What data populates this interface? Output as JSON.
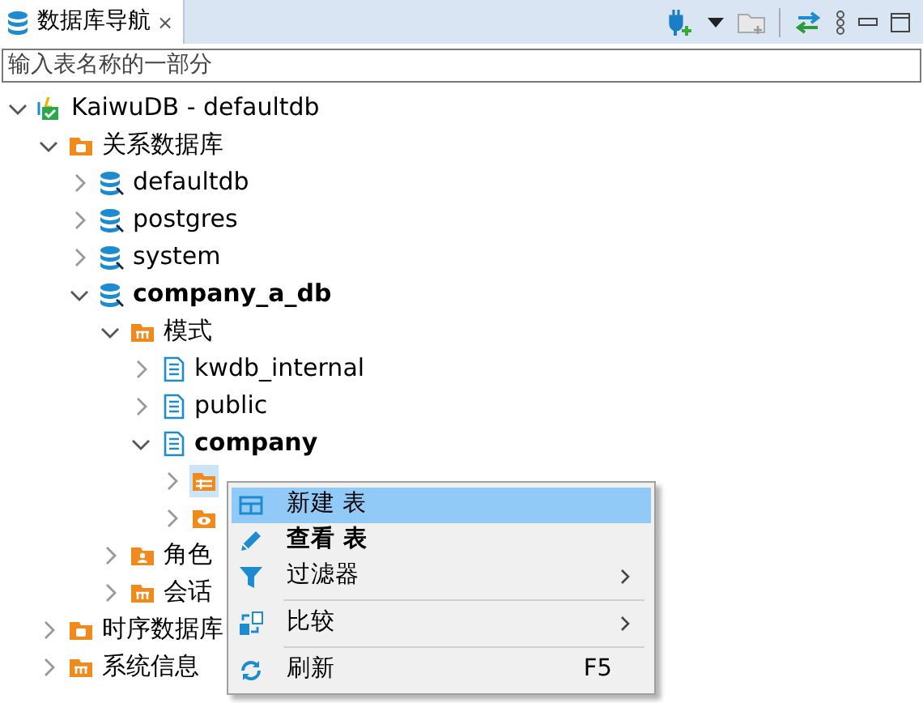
{
  "tab": {
    "title": "数据库导航",
    "close": "⨯"
  },
  "search": {
    "placeholder": "输入表名称的一部分"
  },
  "tree": [
    {
      "label": "KaiwuDB - defaultdb",
      "kind": "connection",
      "expanded": true,
      "bold": false,
      "selected": false,
      "children": [
        {
          "label": "关系数据库",
          "kind": "folder",
          "expanded": true,
          "bold": false,
          "selected": false,
          "children": [
            {
              "label": "defaultdb",
              "kind": "database",
              "expanded": false,
              "bold": false,
              "selected": false
            },
            {
              "label": "postgres",
              "kind": "database",
              "expanded": false,
              "bold": false,
              "selected": false
            },
            {
              "label": "system",
              "kind": "database",
              "expanded": false,
              "bold": false,
              "selected": false
            },
            {
              "label": "company_a_db",
              "kind": "database",
              "expanded": true,
              "bold": true,
              "selected": false,
              "children": [
                {
                  "label": "模式",
                  "kind": "grid",
                  "expanded": true,
                  "bold": false,
                  "selected": false,
                  "children": [
                    {
                      "label": "kwdb_internal",
                      "kind": "schema",
                      "expanded": false,
                      "bold": false,
                      "selected": false
                    },
                    {
                      "label": "public",
                      "kind": "schema",
                      "expanded": false,
                      "bold": false,
                      "selected": false
                    },
                    {
                      "label": "company",
                      "kind": "schema",
                      "expanded": true,
                      "bold": true,
                      "selected": false,
                      "children": [
                        {
                          "kind": "tables",
                          "expanded": false,
                          "selected": true
                        },
                        {
                          "kind": "views",
                          "expanded": false,
                          "selected": false
                        }
                      ]
                    }
                  ]
                },
                {
                  "label": "角色",
                  "kind": "roles",
                  "expanded": false,
                  "bold": false,
                  "selected": false
                },
                {
                  "label": "会话",
                  "kind": "grid",
                  "expanded": false,
                  "bold": false,
                  "selected": false
                }
              ]
            }
          ]
        },
        {
          "label": "时序数据库",
          "kind": "folder",
          "expanded": false,
          "bold": false,
          "selected": false
        },
        {
          "label": "系统信息",
          "kind": "grid",
          "expanded": false,
          "bold": false,
          "selected": false
        }
      ]
    }
  ],
  "context_menu": [
    {
      "kind": "item",
      "label": "新建 表",
      "bold": false,
      "selected": true,
      "submenu": false
    },
    {
      "kind": "item",
      "label": "查看 表",
      "bold": true,
      "selected": false,
      "submenu": false
    },
    {
      "kind": "item",
      "label": "过滤器",
      "bold": false,
      "selected": false,
      "submenu": true
    },
    {
      "kind": "separator"
    },
    {
      "kind": "item",
      "label": "比较",
      "bold": false,
      "selected": false,
      "submenu": true
    },
    {
      "kind": "separator"
    },
    {
      "kind": "item",
      "label": "刷新",
      "bold": false,
      "selected": false,
      "submenu": false,
      "shortcut": "F5"
    }
  ]
}
